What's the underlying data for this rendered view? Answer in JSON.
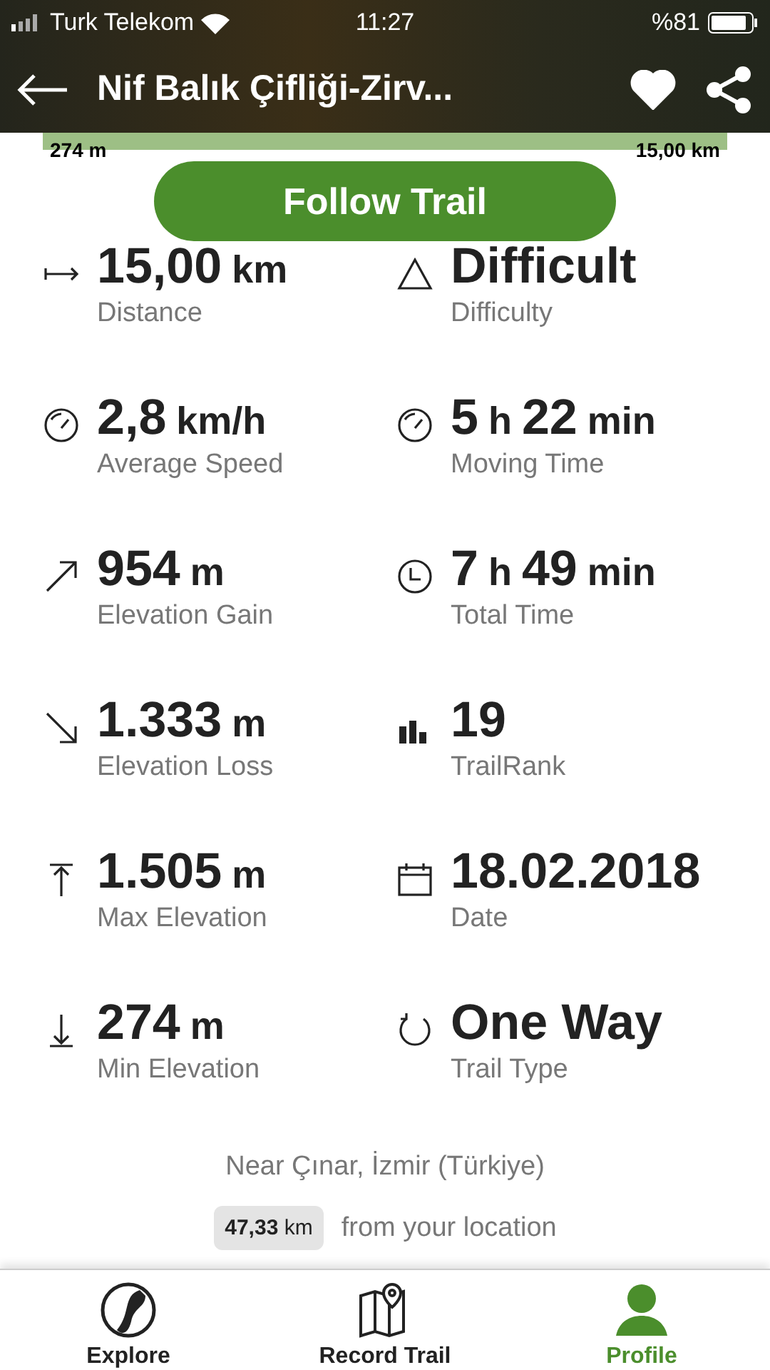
{
  "status_bar": {
    "carrier": "Turk Telekom",
    "time": "11:27",
    "battery": "%81"
  },
  "header": {
    "title": "Nif Balık Çifliği-Zirv...",
    "favorite": true
  },
  "elevation_strip": {
    "start": "274 m",
    "end": "15,00 km"
  },
  "follow_button": "Follow Trail",
  "stats": [
    {
      "kind": "distance",
      "parts": [
        {
          "text": "15,00",
          "kind": "num"
        },
        {
          "text": "km",
          "kind": "unit"
        }
      ],
      "label": "Distance"
    },
    {
      "kind": "difficulty",
      "parts": [
        {
          "text": "Difficult",
          "kind": "num"
        }
      ],
      "label": "Difficulty"
    },
    {
      "kind": "speed",
      "parts": [
        {
          "text": "2,8",
          "kind": "num"
        },
        {
          "text": "km/h",
          "kind": "unit"
        }
      ],
      "label": "Average Speed"
    },
    {
      "kind": "speed",
      "parts": [
        {
          "text": "5",
          "kind": "num"
        },
        {
          "text": "h",
          "kind": "unit"
        },
        {
          "text": "22",
          "kind": "num"
        },
        {
          "text": "min",
          "kind": "unit"
        }
      ],
      "label": "Moving Time"
    },
    {
      "kind": "gain",
      "parts": [
        {
          "text": "954",
          "kind": "num"
        },
        {
          "text": "m",
          "kind": "unit"
        }
      ],
      "label": "Elevation Gain"
    },
    {
      "kind": "clock",
      "parts": [
        {
          "text": "7",
          "kind": "num"
        },
        {
          "text": "h",
          "kind": "unit"
        },
        {
          "text": "49",
          "kind": "num"
        },
        {
          "text": "min",
          "kind": "unit"
        }
      ],
      "label": "Total Time"
    },
    {
      "kind": "loss",
      "parts": [
        {
          "text": "1.333",
          "kind": "num"
        },
        {
          "text": "m",
          "kind": "unit"
        }
      ],
      "label": "Elevation Loss"
    },
    {
      "kind": "rank",
      "parts": [
        {
          "text": "19",
          "kind": "num"
        }
      ],
      "label": "TrailRank"
    },
    {
      "kind": "max",
      "parts": [
        {
          "text": "1.505",
          "kind": "num"
        },
        {
          "text": "m",
          "kind": "unit"
        }
      ],
      "label": "Max Elevation"
    },
    {
      "kind": "date",
      "parts": [
        {
          "text": "18.02.2018",
          "kind": "num"
        }
      ],
      "label": "Date"
    },
    {
      "kind": "min",
      "parts": [
        {
          "text": "274",
          "kind": "num"
        },
        {
          "text": "m",
          "kind": "unit"
        }
      ],
      "label": "Min Elevation"
    },
    {
      "kind": "oneway",
      "parts": [
        {
          "text": "One Way",
          "kind": "num"
        }
      ],
      "label": "Trail Type"
    }
  ],
  "location": "Near Çınar, İzmir (Türkiye)",
  "distance_chip": "**47,33** km",
  "distance_note": "from your location",
  "tabs": [
    {
      "kind": "explore",
      "label": "Explore",
      "selected": false
    },
    {
      "kind": "record",
      "label": "Record Trail",
      "selected": false
    },
    {
      "kind": "profile",
      "label": "Profile",
      "selected": true
    }
  ]
}
